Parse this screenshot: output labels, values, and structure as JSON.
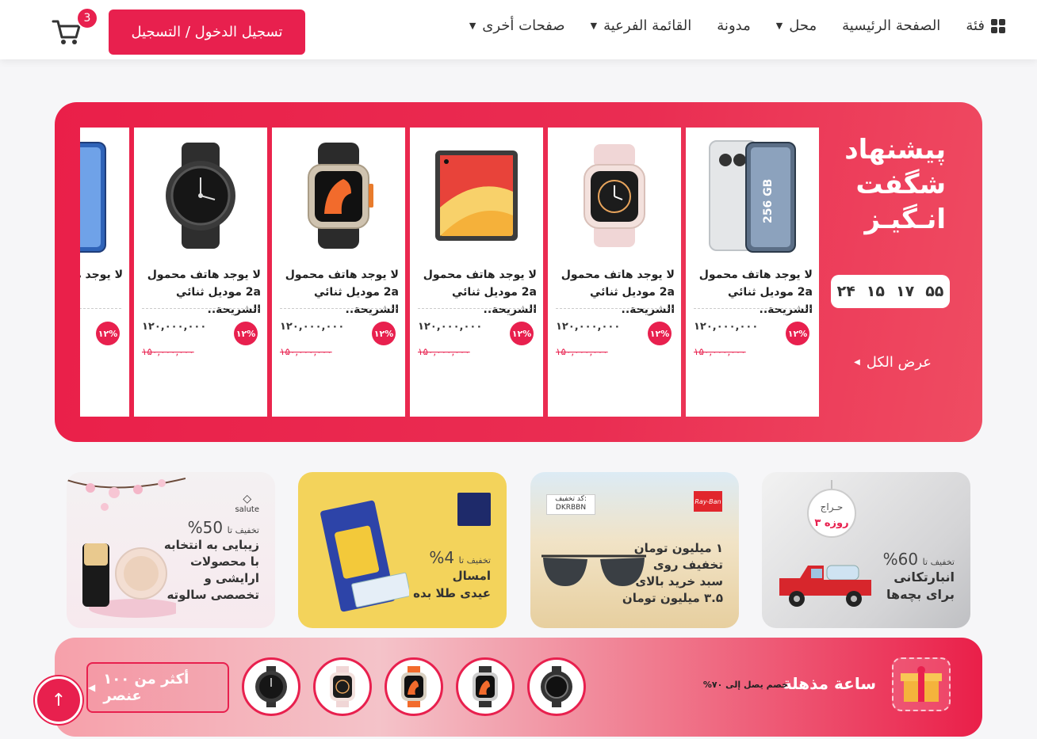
{
  "header": {
    "nav": [
      {
        "label": "فئة",
        "icon": "grid-icon",
        "caret": false
      },
      {
        "label": "الصفحة الرئيسية",
        "caret": false
      },
      {
        "label": "محل",
        "caret": true
      },
      {
        "label": "مدونة",
        "caret": false
      },
      {
        "label": "القائمة الفرعية",
        "caret": true
      },
      {
        "label": "صفحات أخرى",
        "caret": true
      }
    ],
    "login_label": "تسجيل الدخول / التسجيل",
    "cart_count": "3",
    "accent": "#e8204e"
  },
  "offer": {
    "title_line1": "پیشنهاد",
    "title_line2": "شگفت",
    "title_line3": "انـگیـز",
    "timer": [
      "۲۴",
      "۱۵",
      "۱۷",
      "۵۵"
    ],
    "view_all": "عرض الكل",
    "products": [
      {
        "name": "لا يوجد هاتف محمول 2a موديل ثنائي الشريحة..",
        "price": "۱۲۰,۰۰۰,۰۰۰",
        "old_price": "۱۵۰,۰۰۰,۰۰۰",
        "discount": "۱۲%",
        "icon": "phone-icon"
      },
      {
        "name": "لا يوجد هاتف محمول 2a موديل ثنائي الشريحة..",
        "price": "۱۲۰,۰۰۰,۰۰۰",
        "old_price": "۱۵۰,۰۰۰,۰۰۰",
        "discount": "۱۲%",
        "icon": "smartwatch-icon"
      },
      {
        "name": "لا يوجد هاتف محمول 2a موديل ثنائي الشريحة..",
        "price": "۱۲۰,۰۰۰,۰۰۰",
        "old_price": "۱۵۰,۰۰۰,۰۰۰",
        "discount": "۱۲%",
        "icon": "tablet-icon"
      },
      {
        "name": "لا يوجد هاتف محمول 2a موديل ثنائي الشريحة..",
        "price": "۱۲۰,۰۰۰,۰۰۰",
        "old_price": "۱۵۰,۰۰۰,۰۰۰",
        "discount": "۱۲%",
        "icon": "ultra-watch-icon"
      },
      {
        "name": "لا يوجد هاتف محمول 2a موديل ثنائي الشريحة..",
        "price": "۱۲۰,۰۰۰,۰۰۰",
        "old_price": "۱۵۰,۰۰۰,۰۰۰",
        "discount": "۱۲%",
        "icon": "round-watch-icon"
      },
      {
        "name": "لا يوجد ه موديل ثنائ",
        "price": "",
        "old_price": "",
        "discount": "۱۲%",
        "icon": "phone-icon"
      }
    ]
  },
  "banners": [
    {
      "small": "تخفیف تا",
      "pct": "60%",
      "line1": "انبارتکانی",
      "line2": "برای بچه‌ها",
      "tag1": "حـراج",
      "tag2": "۳ روزه"
    },
    {
      "line1": "۱ میلیون تومان",
      "line2": "تخفیف روی",
      "line3": "سبد خرید بالای",
      "line4": "۳.۵ میلیون تومان",
      "code_label": "کد تخفیف:",
      "code": "DKRBBN",
      "brand": "Ray-Ban"
    },
    {
      "small": "تخفیف تا",
      "pct": "4%",
      "line1": "امسال",
      "line2": "عیدی طلا بده"
    },
    {
      "small": "تخفیف تا",
      "pct": "50%",
      "line1": "زیبایی به انتخابه",
      "line2": "با محصولات",
      "line3": "ارایشی و",
      "line4": "تخصصی سالوته",
      "brand": "salute"
    }
  ],
  "flash": {
    "title": "ساعة مذهلة",
    "subtitle": "خصم يصل إلى ٧٠%",
    "more_label": "أكثر من ١٠٠ عنصر"
  }
}
